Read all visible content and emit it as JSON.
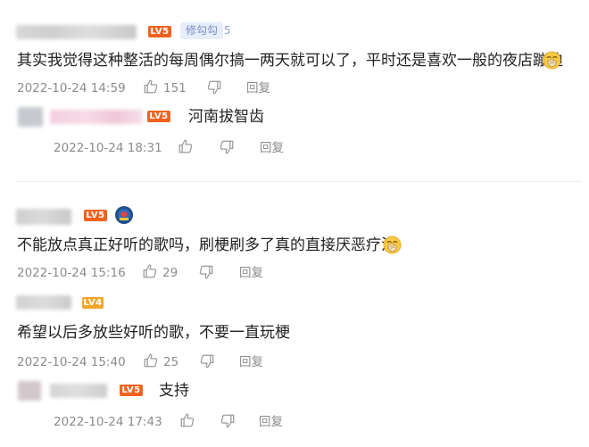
{
  "comments": [
    {
      "badge": "LV5",
      "title_badge": "修勾勾",
      "title_badge_num": "5",
      "text": "其实我觉得这种整活的每周偶尔搞一两天就可以了，平时还是喜欢一般的夜店蹦迪",
      "time": "2022-10-24 14:59",
      "likes": "151",
      "reply_label": "回复",
      "replies": [
        {
          "badge": "LV5",
          "text": "河南拔智齿",
          "time": "2022-10-24 18:31",
          "likes": "",
          "reply_label": "回复"
        }
      ]
    },
    {
      "badge": "LV5",
      "text": "不能放点真正好听的歌吗，刷梗刷多了真的直接厌恶疗法",
      "time": "2022-10-24 15:16",
      "likes": "29",
      "reply_label": "回复",
      "replies": [
        {
          "badge": "LV4",
          "text": "希望以后多放些好听的歌，不要一直玩梗",
          "time": "2022-10-24 15:40",
          "likes": "25",
          "reply_label": "回复"
        },
        {
          "badge": "LV5",
          "text": "支持",
          "time": "2022-10-24 17:43",
          "likes": "",
          "reply_label": "回复"
        }
      ]
    }
  ]
}
